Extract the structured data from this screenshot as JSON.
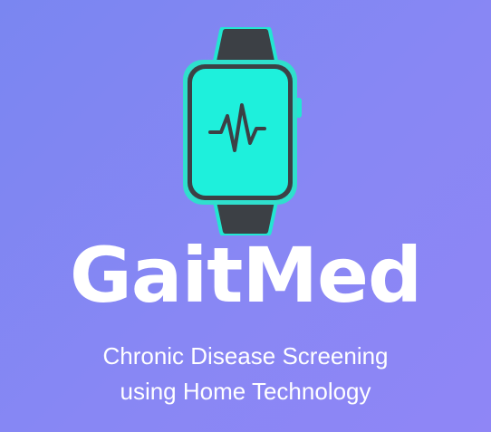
{
  "colors": {
    "background_start": "#7a86f1",
    "background_end": "#8f86f6",
    "watch_strap": "#3c4045",
    "watch_screen": "#1ef0dc",
    "watch_frame_glow": "#2fdfcd",
    "text": "#ffffff"
  },
  "logo": {
    "icon": "smartwatch-heartbeat-icon"
  },
  "brand": {
    "name": "GaitMed"
  },
  "tagline": {
    "line1": "Chronic Disease Screening",
    "line2": "using Home Technology"
  }
}
